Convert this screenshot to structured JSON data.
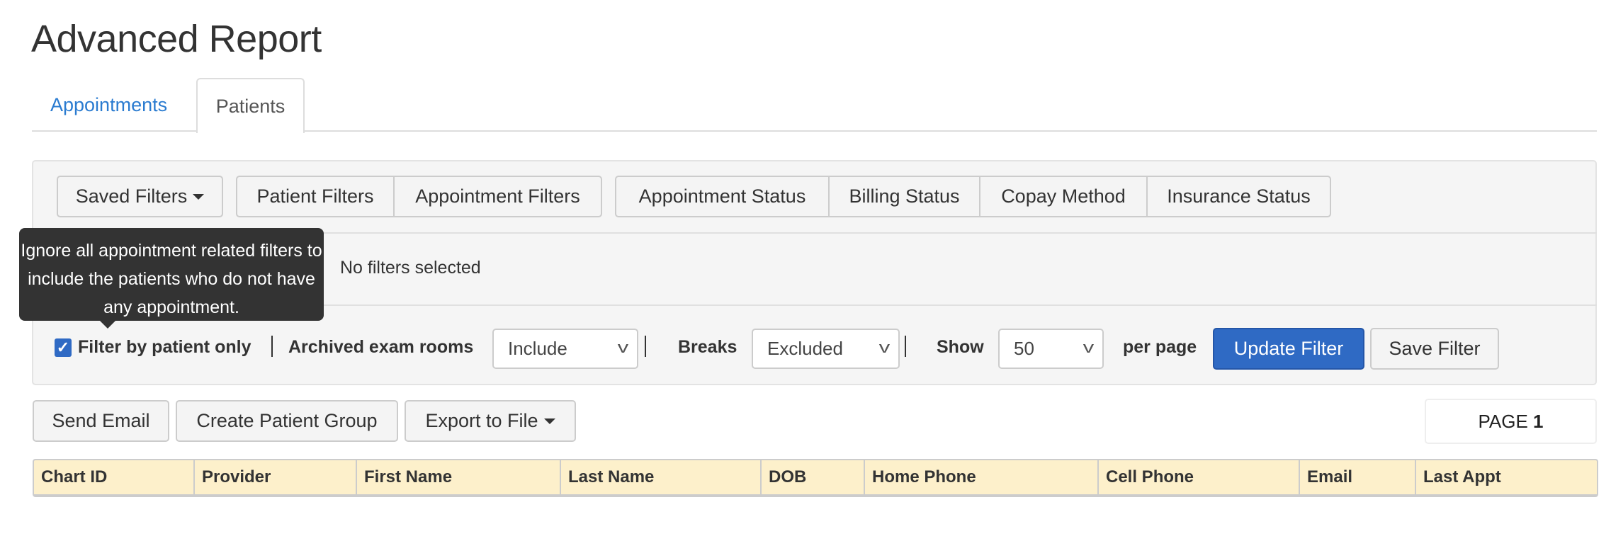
{
  "page_title": "Advanced Report",
  "tabs": [
    {
      "label": "Appointments",
      "active": false
    },
    {
      "label": "Patients",
      "active": true
    }
  ],
  "filter_buttons": {
    "saved_filters": "Saved Filters",
    "patient_filters": "Patient Filters",
    "appointment_filters": "Appointment Filters",
    "appointment_status": "Appointment Status",
    "billing_status": "Billing Status",
    "copay_method": "Copay Method",
    "insurance_status": "Insurance Status"
  },
  "no_filters_text": "No filters selected",
  "tooltip": "Ignore all appointment related filters to include the patients who do not have any appointment.",
  "options": {
    "filter_by_patient_only": {
      "label": "Filter by patient only",
      "checked": true
    },
    "archived_exam_rooms": {
      "label": "Archived exam rooms",
      "value": "Include"
    },
    "breaks": {
      "label": "Breaks",
      "value": "Excluded"
    },
    "show": {
      "label": "Show",
      "value": "50",
      "suffix": "per page"
    },
    "update_filter": "Update Filter",
    "save_filter": "Save Filter"
  },
  "actions": {
    "send_email": "Send Email",
    "create_patient_group": "Create Patient Group",
    "export_to_file": "Export to File"
  },
  "pagination": {
    "prefix": "PAGE",
    "page": "1"
  },
  "table": {
    "columns": [
      "Chart ID",
      "Provider",
      "First Name",
      "Last Name",
      "DOB",
      "Home Phone",
      "Cell Phone",
      "Email",
      "Last Appt"
    ]
  },
  "colors": {
    "accent": "#2f6ac4",
    "link": "#2a7bd0",
    "table_header": "#fdf0cb",
    "tooltip": "#333333"
  }
}
